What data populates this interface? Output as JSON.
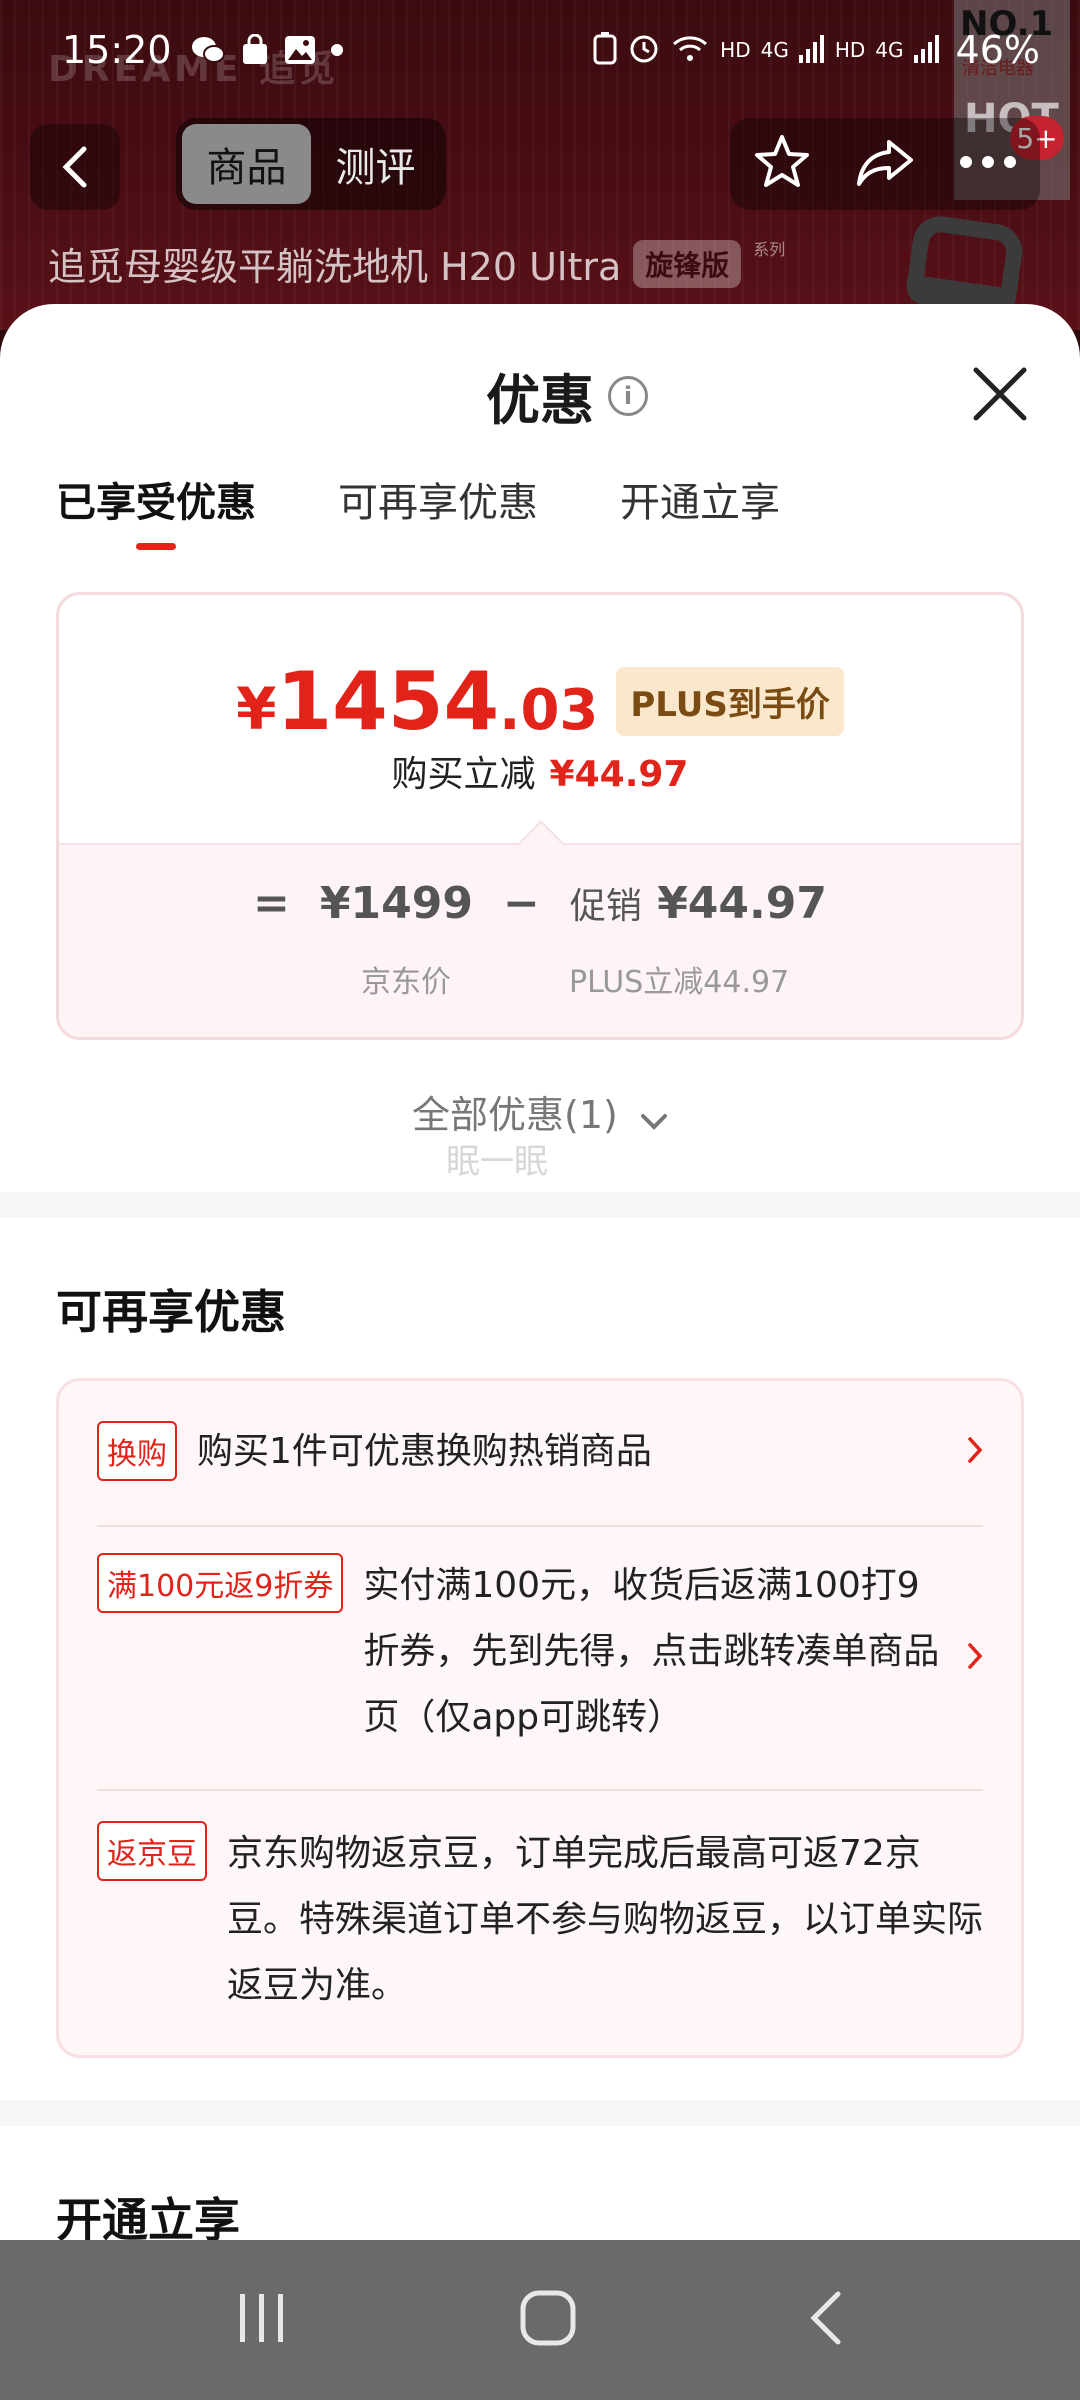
{
  "status_bar": {
    "time": "15:20",
    "network_labels": [
      "HD",
      "4G",
      "HD",
      "4G"
    ],
    "battery": "46%"
  },
  "background": {
    "brand": "DREAME 追觅",
    "badge_top": "NO.1",
    "badge_sub": "清洁电器",
    "badge_hot": "HOT",
    "badge_count": "5+"
  },
  "nav": {
    "tabs": [
      "商品",
      "测评"
    ]
  },
  "product": {
    "title": "追觅母婴级平躺洗地机 H20 Ultra",
    "series_tag": "旋锋版",
    "series_sub": "系列"
  },
  "sheet": {
    "title": "优惠",
    "tabs": [
      "已享受优惠",
      "可再享优惠",
      "开通立享"
    ],
    "active_tab": 0,
    "price_card": {
      "symbol": "¥",
      "price_int": "1454",
      "price_dec": ".03",
      "badge": "PLUS到手价",
      "reduce_label": "购买立减",
      "reduce_amount": "¥44.97",
      "eq": "=",
      "base_price": "¥1499",
      "minus": "−",
      "promo_label": "促销",
      "promo_amount": "¥44.97",
      "base_caption": "京东价",
      "promo_caption": "PLUS立减44.97"
    },
    "all_offers": "全部优惠(1)",
    "ghost_text": "眠一眠",
    "section_more": {
      "title": "可再享优惠",
      "offers": [
        {
          "tag": "换购",
          "text": "购买1件可优惠换购热销商品"
        },
        {
          "tag": "满100元返9折券",
          "text": "实付满100元，收货后返满100打9折券，先到先得，点击跳转凑单商品页（仅app可跳转）"
        },
        {
          "tag": "返京豆",
          "text": "京东购物返京豆，订单完成后最高可返72京豆。特殊渠道订单不参与购物返豆，以订单实际返豆为准。"
        }
      ]
    },
    "section_open": {
      "title": "开通立享"
    }
  },
  "colors": {
    "accent_red": "#e2231a",
    "badge_bg": "#fbe8cc",
    "card_tint": "#fff6f7",
    "sys_nav": "#6a6a6a"
  }
}
